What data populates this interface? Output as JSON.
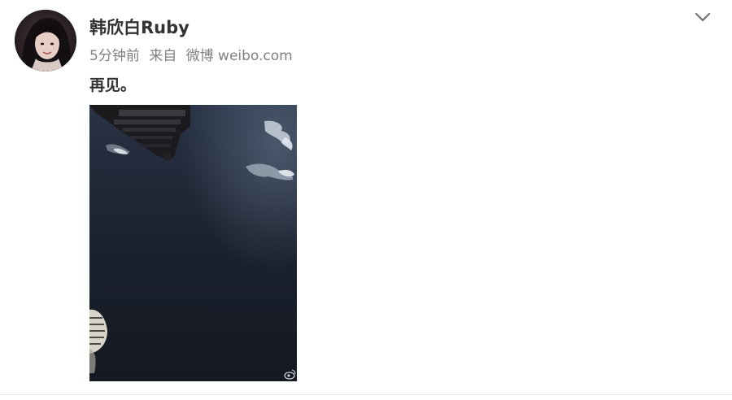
{
  "post": {
    "author_name": "韩欣白Ruby",
    "time_ago": "5分钟前",
    "source_prefix": "来自",
    "source_client": "微博 weibo.com",
    "text": "再见。"
  },
  "icons": {
    "more": "chevron-down-icon",
    "watermark": "weibo-watermark-icon"
  },
  "colors": {
    "author": "#333333",
    "meta": "#808080",
    "sky": "#1c2330"
  }
}
